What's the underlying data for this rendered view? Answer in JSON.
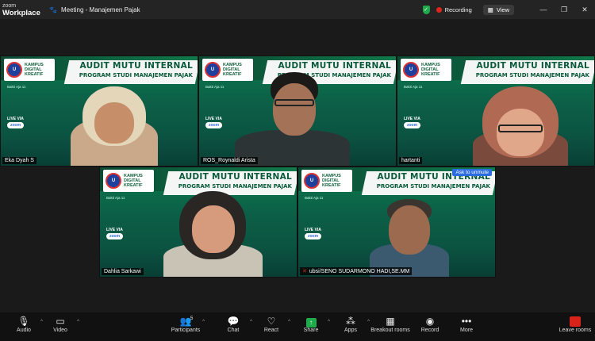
{
  "titlebar": {
    "brand_top": "zoom",
    "brand_bottom": "Workplace",
    "meeting_title": "Meeting - Manajemen Pajak",
    "recording": "Recording",
    "view": "View",
    "shield_color": "#1faa4b",
    "recording_color": "#e0241b"
  },
  "banner": {
    "title": "AUDIT MUTU INTERNAL",
    "subtitle": "PROGRAM STUDI MANAJEMEN PAJAK",
    "logo_line1": "KAMPUS",
    "logo_line2": "DIGITAL",
    "logo_line3": "KREATIF",
    "live_via": "LIVE VIA",
    "zoom": "zoom",
    "tagline": "Bakti Aja 11"
  },
  "participants": [
    {
      "name": "Eka Dyah S"
    },
    {
      "name": "ROS_Roynaldi Arista"
    },
    {
      "name": "hartanti"
    },
    {
      "name": "Dahlia Sarkawi"
    },
    {
      "name": "ubsi/SENO SUDARMONO HADI,SE.MM",
      "ask_label": "Ask to unmute"
    }
  ],
  "toolbar": {
    "audio": "Audio",
    "video": "Video",
    "participants": "Participants",
    "participants_count": "5",
    "chat": "Chat",
    "react": "React",
    "share": "Share",
    "apps": "Apps",
    "breakout": "Breakout rooms",
    "record": "Record",
    "more": "More",
    "leave": "Leave rooms",
    "share_color": "#1faa4b",
    "leave_color": "#d8231b"
  }
}
